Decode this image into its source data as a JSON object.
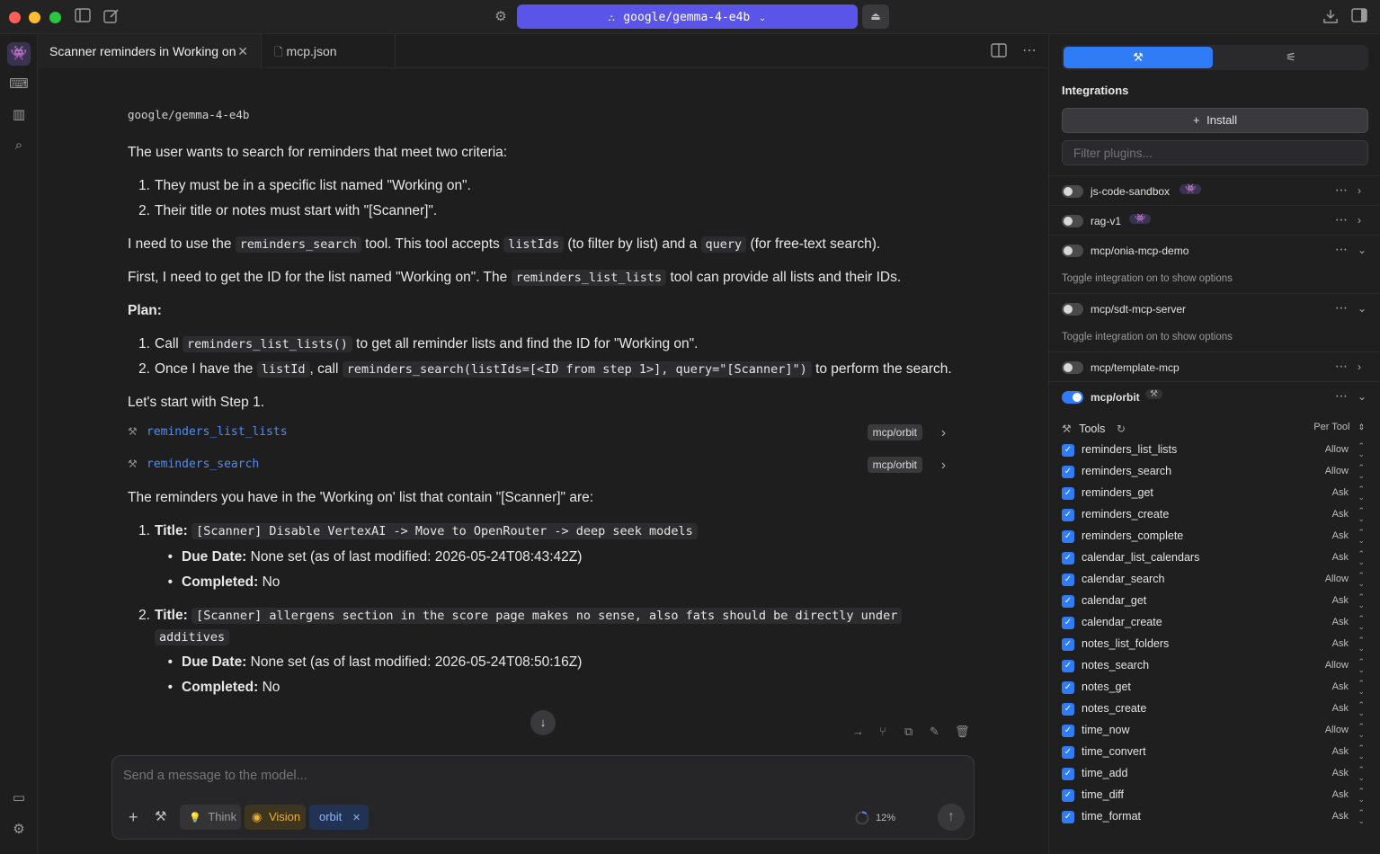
{
  "titlebar": {
    "model": "google/gemma-4-e4b"
  },
  "tabs": [
    {
      "label": "Scanner reminders in Working on"
    },
    {
      "label": "mcp.json"
    }
  ],
  "chat": {
    "model_label": "google/gemma-4-e4b",
    "p1": "The user wants to search for reminders that meet two criteria:",
    "crit1_num": "1.",
    "crit1": "They must be in a specific list named \"Working on\".",
    "crit2_num": "2.",
    "crit2": "Their title or notes must start with \"[Scanner]\".",
    "p2a": "I need to use the",
    "p2_code1": "reminders_search",
    "p2b": "tool. This tool accepts",
    "p2_code2": "listIds",
    "p2c": "(to filter by list) and a",
    "p2_code3": "query",
    "p2d": "(for free-text search).",
    "p3a": "First, I need to get the ID for the list named \"Working on\". The",
    "p3_code": "reminders_list_lists",
    "p3b": "tool can provide all lists and their IDs.",
    "plan": "Plan:",
    "plan1_num": "1.",
    "plan1a": "Call",
    "plan1_code": "reminders_list_lists()",
    "plan1b": "to get all reminder lists and find the ID for \"Working on\".",
    "plan2_num": "2.",
    "plan2a": "Once I have the",
    "plan2_code1": "listId",
    "plan2b": ", call",
    "plan2_code2": "reminders_search(listIds=[<ID from step 1>], query=\"[Scanner]\")",
    "plan2c": "to perform the search.",
    "p4": "Let's start with Step 1.",
    "tool_calls": [
      {
        "name": "reminders_list_lists",
        "badge": "mcp/orbit"
      },
      {
        "name": "reminders_search",
        "badge": "mcp/orbit"
      }
    ],
    "p5": "The reminders you have in the 'Working on' list that contain \"[Scanner]\" are:",
    "r1_num": "1.",
    "r1_title_label": "Title:",
    "r1_title": "[Scanner] Disable VertexAI -> Move to OpenRouter -> deep seek models",
    "r1_due_label": "Due Date:",
    "r1_due": "None set (as of last modified: 2026-05-24T08:43:42Z)",
    "r1_done_label": "Completed:",
    "r1_done": "No",
    "r2_num": "2.",
    "r2_title_label": "Title:",
    "r2_title_a": "[Scanner] allergens section in the score page makes no sense, also fats should be directly under",
    "r2_title_b": "additives",
    "r2_due_label": "Due Date:",
    "r2_due": "None set (as of last modified: 2026-05-24T08:50:16Z)",
    "r2_done_label": "Completed:",
    "r2_done": "No"
  },
  "composer": {
    "placeholder": "Send a message to the model...",
    "think": "Think",
    "vision": "Vision",
    "orbit": "orbit",
    "progress": "12%"
  },
  "panel": {
    "heading": "Integrations",
    "install": "Install",
    "filter_placeholder": "Filter plugins...",
    "hint": "Toggle integration on to show options",
    "plugins": [
      {
        "name": "js-code-sandbox",
        "on": false
      },
      {
        "name": "rag-v1",
        "on": false
      },
      {
        "name": "mcp/onia-mcp-demo",
        "on": false
      },
      {
        "name": "mcp/sdt-mcp-server",
        "on": false
      },
      {
        "name": "mcp/template-mcp",
        "on": false
      },
      {
        "name": "mcp/orbit",
        "on": true
      }
    ],
    "tools_label": "Tools",
    "per_tool": "Per Tool",
    "tools": [
      {
        "name": "reminders_list_lists",
        "perm": "Allow"
      },
      {
        "name": "reminders_search",
        "perm": "Allow"
      },
      {
        "name": "reminders_get",
        "perm": "Ask"
      },
      {
        "name": "reminders_create",
        "perm": "Ask"
      },
      {
        "name": "reminders_complete",
        "perm": "Ask"
      },
      {
        "name": "calendar_list_calendars",
        "perm": "Ask"
      },
      {
        "name": "calendar_search",
        "perm": "Allow"
      },
      {
        "name": "calendar_get",
        "perm": "Ask"
      },
      {
        "name": "calendar_create",
        "perm": "Ask"
      },
      {
        "name": "notes_list_folders",
        "perm": "Ask"
      },
      {
        "name": "notes_search",
        "perm": "Allow"
      },
      {
        "name": "notes_get",
        "perm": "Ask"
      },
      {
        "name": "notes_create",
        "perm": "Ask"
      },
      {
        "name": "time_now",
        "perm": "Allow"
      },
      {
        "name": "time_convert",
        "perm": "Ask"
      },
      {
        "name": "time_add",
        "perm": "Ask"
      },
      {
        "name": "time_diff",
        "perm": "Ask"
      },
      {
        "name": "time_format",
        "perm": "Ask"
      }
    ]
  }
}
